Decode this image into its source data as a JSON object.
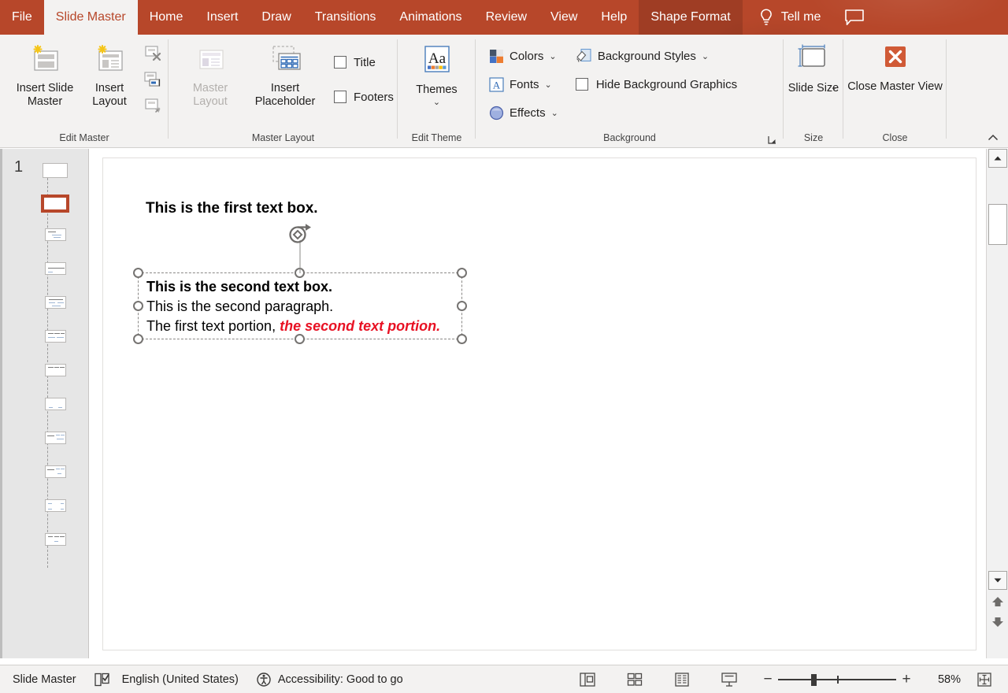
{
  "tabs": [
    {
      "label": "File",
      "state": "file"
    },
    {
      "label": "Slide Master",
      "state": "active"
    },
    {
      "label": "Home",
      "state": "normal"
    },
    {
      "label": "Insert",
      "state": "normal"
    },
    {
      "label": "Draw",
      "state": "normal"
    },
    {
      "label": "Transitions",
      "state": "normal"
    },
    {
      "label": "Animations",
      "state": "normal"
    },
    {
      "label": "Review",
      "state": "normal"
    },
    {
      "label": "View",
      "state": "normal"
    },
    {
      "label": "Help",
      "state": "normal"
    },
    {
      "label": "Shape Format",
      "state": "contextual"
    }
  ],
  "tellme": {
    "label": "Tell me",
    "icon": "lightbulb-icon"
  },
  "comments": {
    "icon": "comment-icon"
  },
  "ribbon": {
    "groups": [
      {
        "label": "Edit Master",
        "big_buttons": [
          {
            "label": "Insert Slide Master",
            "icon": "insert-slide-master-icon",
            "disabled": false
          },
          {
            "label": "Insert Layout",
            "icon": "insert-layout-icon",
            "disabled": false
          }
        ],
        "small_buttons": [
          {
            "name": "delete-icon"
          },
          {
            "name": "rename-icon"
          },
          {
            "name": "preserve-icon"
          }
        ]
      },
      {
        "label": "Master Layout",
        "big_buttons": [
          {
            "label": "Master Layout",
            "icon": "master-layout-icon",
            "disabled": true
          },
          {
            "label": "Insert Placeholder",
            "icon": "insert-placeholder-icon",
            "disabled": false,
            "has_chevron": true
          }
        ],
        "checkboxes": [
          {
            "label": "Title",
            "checked": false
          },
          {
            "label": "Footers",
            "checked": false
          }
        ]
      },
      {
        "label": "Edit Theme",
        "big_buttons": [
          {
            "label": "Themes",
            "icon": "themes-icon",
            "disabled": false,
            "has_chevron": true
          }
        ]
      },
      {
        "label": "Background",
        "items": [
          {
            "label": "Colors",
            "icon": "colors-icon",
            "has_chevron": true
          },
          {
            "label": "Fonts",
            "icon": "fonts-icon",
            "has_chevron": true
          },
          {
            "label": "Effects",
            "icon": "effects-icon",
            "has_chevron": true
          },
          {
            "label": "Background Styles",
            "icon": "background-styles-icon",
            "has_chevron": true
          },
          {
            "label": "Hide Background Graphics",
            "icon": "checkbox",
            "checked": false
          }
        ],
        "dialog_launcher": "background-dialog-launcher"
      },
      {
        "label": "Size",
        "big_buttons": [
          {
            "label": "Slide Size",
            "icon": "slide-size-icon",
            "disabled": false,
            "has_chevron": true
          }
        ]
      },
      {
        "label": "Close",
        "big_buttons": [
          {
            "label": "Close Master View",
            "icon": "close-master-view-icon",
            "disabled": false
          }
        ]
      }
    ],
    "collapse_icon": "collapse-ribbon-icon"
  },
  "thumbnails": {
    "master_number": "1",
    "layouts": [
      {
        "index": 0,
        "selected": true
      },
      {
        "index": 1,
        "selected": false
      },
      {
        "index": 2,
        "selected": false
      },
      {
        "index": 3,
        "selected": false
      },
      {
        "index": 4,
        "selected": false
      },
      {
        "index": 5,
        "selected": false
      },
      {
        "index": 6,
        "selected": false
      },
      {
        "index": 7,
        "selected": false
      },
      {
        "index": 8,
        "selected": false
      },
      {
        "index": 9,
        "selected": false
      },
      {
        "index": 10,
        "selected": false
      }
    ]
  },
  "slide": {
    "first_textbox": "This is the first text box.",
    "selected_textbox": {
      "line1": "This is the second text box.",
      "line2": "This is the second paragraph.",
      "line3_part1": "The first text portion, ",
      "line3_part2": "the second text portion.",
      "part2_color": "#e81123"
    }
  },
  "statusbar": {
    "view_name": "Slide Master",
    "spellcheck_icon": "spellcheck-icon",
    "language": "English (United States)",
    "accessibility_icon": "accessibility-icon",
    "accessibility": "Accessibility: Good to go",
    "view_buttons": [
      {
        "name": "normal-view-button"
      },
      {
        "name": "slide-sorter-button"
      },
      {
        "name": "reading-view-button"
      },
      {
        "name": "slideshow-button"
      }
    ],
    "zoom_out": "−",
    "zoom_in": "+",
    "zoom_level": "58%",
    "fit_button": "fit-slide-to-window-button"
  },
  "scrollbar": {
    "up_icon": "scroll-up-arrow",
    "down_icon": "scroll-down-arrow",
    "prev_slide_icon": "previous-slide-arrow",
    "next_slide_icon": "next-slide-arrow"
  },
  "colors": {
    "brand": "#b7472a",
    "ribbon_bg": "#f3f2f1",
    "accent_red": "#e81123"
  }
}
